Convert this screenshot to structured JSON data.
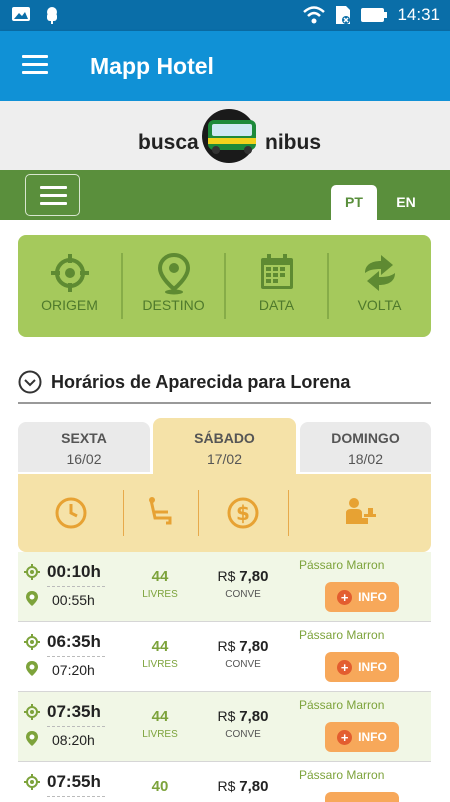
{
  "status": {
    "time": "14:31"
  },
  "appbar": {
    "title": "Mapp Hotel"
  },
  "logo": {
    "word1": "busca",
    "word2": "nibus"
  },
  "lang": {
    "pt": "PT",
    "en": "EN"
  },
  "search": {
    "origem": "ORIGEM",
    "destino": "DESTINO",
    "data": "DATA",
    "volta": "VOLTA"
  },
  "section": {
    "title": "Horários de Aparecida para Lorena"
  },
  "days": [
    {
      "day": "SEXTA",
      "date": "16/02"
    },
    {
      "day": "SÁBADO",
      "date": "17/02"
    },
    {
      "day": "DOMINGO",
      "date": "18/02"
    }
  ],
  "rows": [
    {
      "dep": "00:10h",
      "arr": "00:55h",
      "seats": "44",
      "livres": "LIVRES",
      "currency": "R$",
      "price": "7,80",
      "cls": "CONVE",
      "company": "Pássaro Marron",
      "info": "INFO"
    },
    {
      "dep": "06:35h",
      "arr": "07:20h",
      "seats": "44",
      "livres": "LIVRES",
      "currency": "R$",
      "price": "7,80",
      "cls": "CONVE",
      "company": "Pássaro Marron",
      "info": "INFO"
    },
    {
      "dep": "07:35h",
      "arr": "08:20h",
      "seats": "44",
      "livres": "LIVRES",
      "currency": "R$",
      "price": "7,80",
      "cls": "CONVE",
      "company": "Pássaro Marron",
      "info": "INFO"
    },
    {
      "dep": "07:55h",
      "arr": "",
      "seats": "40",
      "livres": "",
      "currency": "R$",
      "price": "7,80",
      "cls": "",
      "company": "Pássaro Marron",
      "info": ""
    }
  ],
  "colors": {
    "appbar": "#1091d6",
    "green": "#5a8f3c",
    "lightgreen": "#a5c95c",
    "tan": "#f5e2a8",
    "orange": "#f7a85a"
  }
}
